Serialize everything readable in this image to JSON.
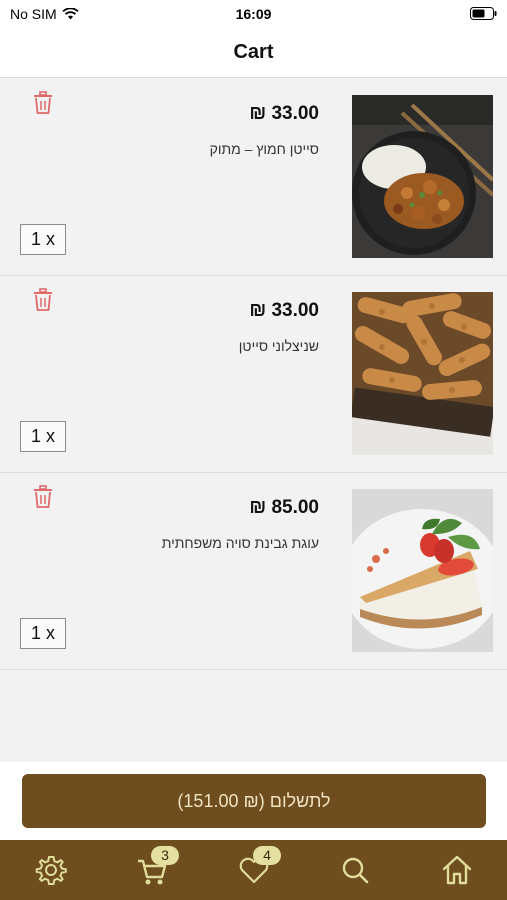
{
  "status_bar": {
    "carrier": "No SIM",
    "time": "16:09"
  },
  "header": {
    "title": "Cart"
  },
  "cart_items": [
    {
      "price": "₪ 33.00",
      "name": "סייטן חמוץ – מתוק",
      "quantity": "1 x",
      "image": "seitan-sweet-sour-photo"
    },
    {
      "price": "₪ 33.00",
      "name": "שניצלוני סייטן",
      "quantity": "1 x",
      "image": "seitan-schnitzel-photo"
    },
    {
      "price": "₪ 85.00",
      "name": "עוגת גבינת סויה משפחתית",
      "quantity": "1 x",
      "image": "soy-cheesecake-photo"
    }
  ],
  "checkout": {
    "label": "לתשלום (₪ 151.00)"
  },
  "tab_bar": {
    "cart_badge": "3",
    "favorites_badge": "4",
    "icons": [
      "gear-icon",
      "cart-icon",
      "heart-icon",
      "search-icon",
      "home-icon"
    ]
  },
  "colors": {
    "brand_brown": "#6e4d1f",
    "button_text": "#efe3c2",
    "badge_bg": "#e4e1a0",
    "icon": "#e0dd9a",
    "trash": "#e06a6a"
  }
}
